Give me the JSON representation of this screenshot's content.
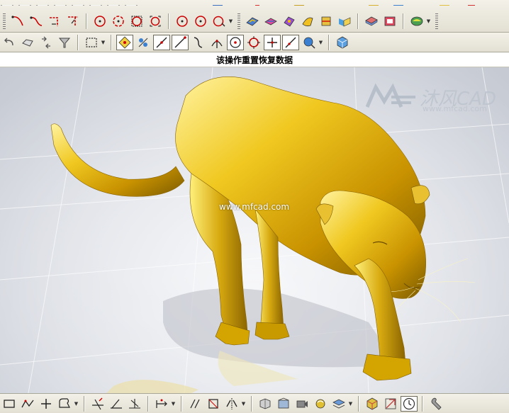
{
  "status": {
    "text": "该操作重置恢复数据"
  },
  "watermark": {
    "center_text": "www.mfcad.com"
  },
  "logo": {
    "name": "沐风CAD",
    "url": "www.mfcad.com"
  },
  "toolbars": {
    "top_row": [
      {
        "icon": "spline-icon"
      },
      {
        "icon": "curve-icon"
      },
      {
        "icon": "corner-icon"
      },
      {
        "icon": "fillet-icon"
      },
      {
        "icon": "circle-center-icon"
      },
      {
        "icon": "arc-point-icon"
      },
      {
        "icon": "circle-square-icon"
      },
      {
        "icon": "circle-bracket-icon"
      },
      {
        "icon": "circle-point-icon"
      },
      {
        "icon": "circle-arc-icon"
      },
      {
        "icon": "circle-arrow-icon"
      },
      {
        "icon": "surface-color-icon"
      },
      {
        "icon": "surface-swap-icon"
      },
      {
        "icon": "surface-edit-icon"
      },
      {
        "icon": "surface-flow-icon"
      },
      {
        "icon": "surface-trim-icon"
      },
      {
        "icon": "surface-map-icon"
      },
      {
        "icon": "book-icon"
      },
      {
        "icon": "card-icon"
      },
      {
        "icon": "shading-icon"
      }
    ],
    "second_row": [
      {
        "icon": "undo-icon"
      },
      {
        "icon": "shape-icon"
      },
      {
        "icon": "select-arrows-icon"
      },
      {
        "icon": "filter-icon"
      },
      {
        "icon": "rectangle-select-icon"
      },
      {
        "icon": "snap-grid-icon",
        "active": true
      },
      {
        "icon": "snap-cross-icon"
      },
      {
        "icon": "snap-line-icon",
        "active": true
      },
      {
        "icon": "snap-end-icon",
        "active": true
      },
      {
        "icon": "snap-curve-icon"
      },
      {
        "icon": "snap-intersection-icon"
      },
      {
        "icon": "snap-center-icon",
        "active": true
      },
      {
        "icon": "snap-circle-icon"
      },
      {
        "icon": "snap-plus-icon",
        "active": true
      },
      {
        "icon": "snap-tangent-icon",
        "active": true
      },
      {
        "icon": "snap-globe-icon"
      },
      {
        "icon": "cube-icon"
      }
    ],
    "bottom_row": [
      {
        "icon": "rectangle-icon"
      },
      {
        "icon": "polyline-icon"
      },
      {
        "icon": "plus-icon"
      },
      {
        "icon": "shape-outline-icon"
      },
      {
        "icon": "trim-icon"
      },
      {
        "icon": "line-angle-icon"
      },
      {
        "icon": "perpendicular-icon"
      },
      {
        "icon": "dimension-icon"
      },
      {
        "icon": "parallel-icon"
      },
      {
        "icon": "constraint-icon"
      },
      {
        "icon": "mirror-icon"
      },
      {
        "icon": "project-icon"
      },
      {
        "icon": "view-orient-icon"
      },
      {
        "icon": "camera-icon"
      },
      {
        "icon": "render-icon"
      },
      {
        "icon": "layer-icon"
      },
      {
        "icon": "cube-view-icon"
      },
      {
        "icon": "clock-icon",
        "active": true
      },
      {
        "icon": "feather-icon"
      },
      {
        "icon": "wrench-icon"
      }
    ]
  },
  "colors": {
    "toolbar_bg": "#ece9dc",
    "model": "#d4a800",
    "highlight": "#fff2a0"
  }
}
